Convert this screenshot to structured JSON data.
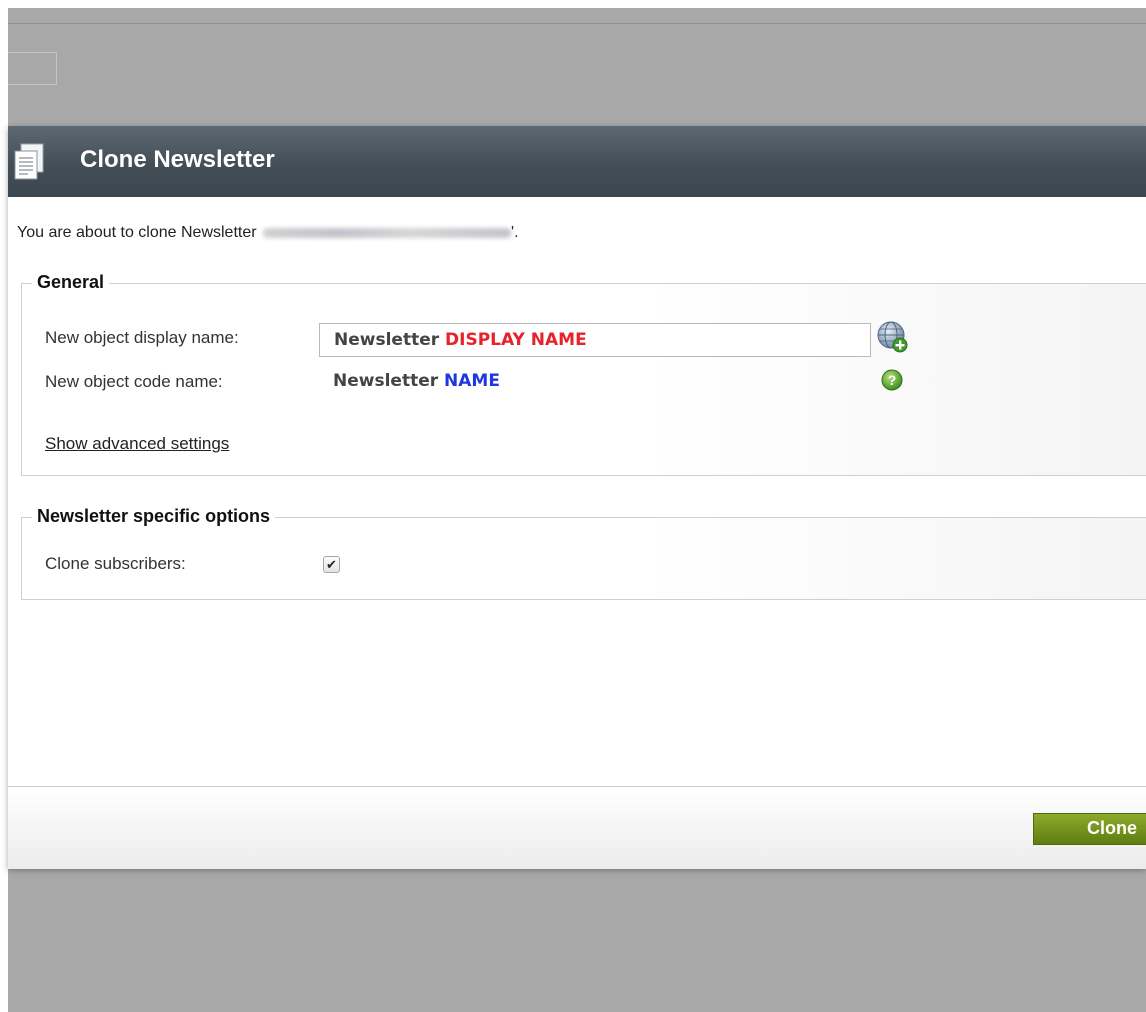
{
  "dialog": {
    "title": "Clone Newsletter",
    "header_icon": "document-icon",
    "intro_prefix": "You are about to clone Newsletter",
    "intro_suffix": "'."
  },
  "general": {
    "legend": "General",
    "display_name_label": "New object display name:",
    "display_name_value_plain": "Newsletter ",
    "display_name_value_highlight": "DISPLAY NAME",
    "code_name_label": "New object code name:",
    "code_name_value_plain": "Newsletter ",
    "code_name_value_highlight": "NAME",
    "advanced_link": "Show advanced settings",
    "localize_icon": "globe-add-icon",
    "help_icon": "help-icon"
  },
  "options": {
    "legend": "Newsletter specific options",
    "clone_subscribers_label": "Clone subscribers:",
    "clone_subscribers_checked": true,
    "check_mark": "✔"
  },
  "footer": {
    "clone_label": "Clone"
  },
  "colors": {
    "header_bg": "#434e57",
    "highlight_red": "#e8222a",
    "highlight_blue": "#1f37e0",
    "button_green": "#6e8c1c",
    "overlay_gray": "#a8a8a8"
  }
}
